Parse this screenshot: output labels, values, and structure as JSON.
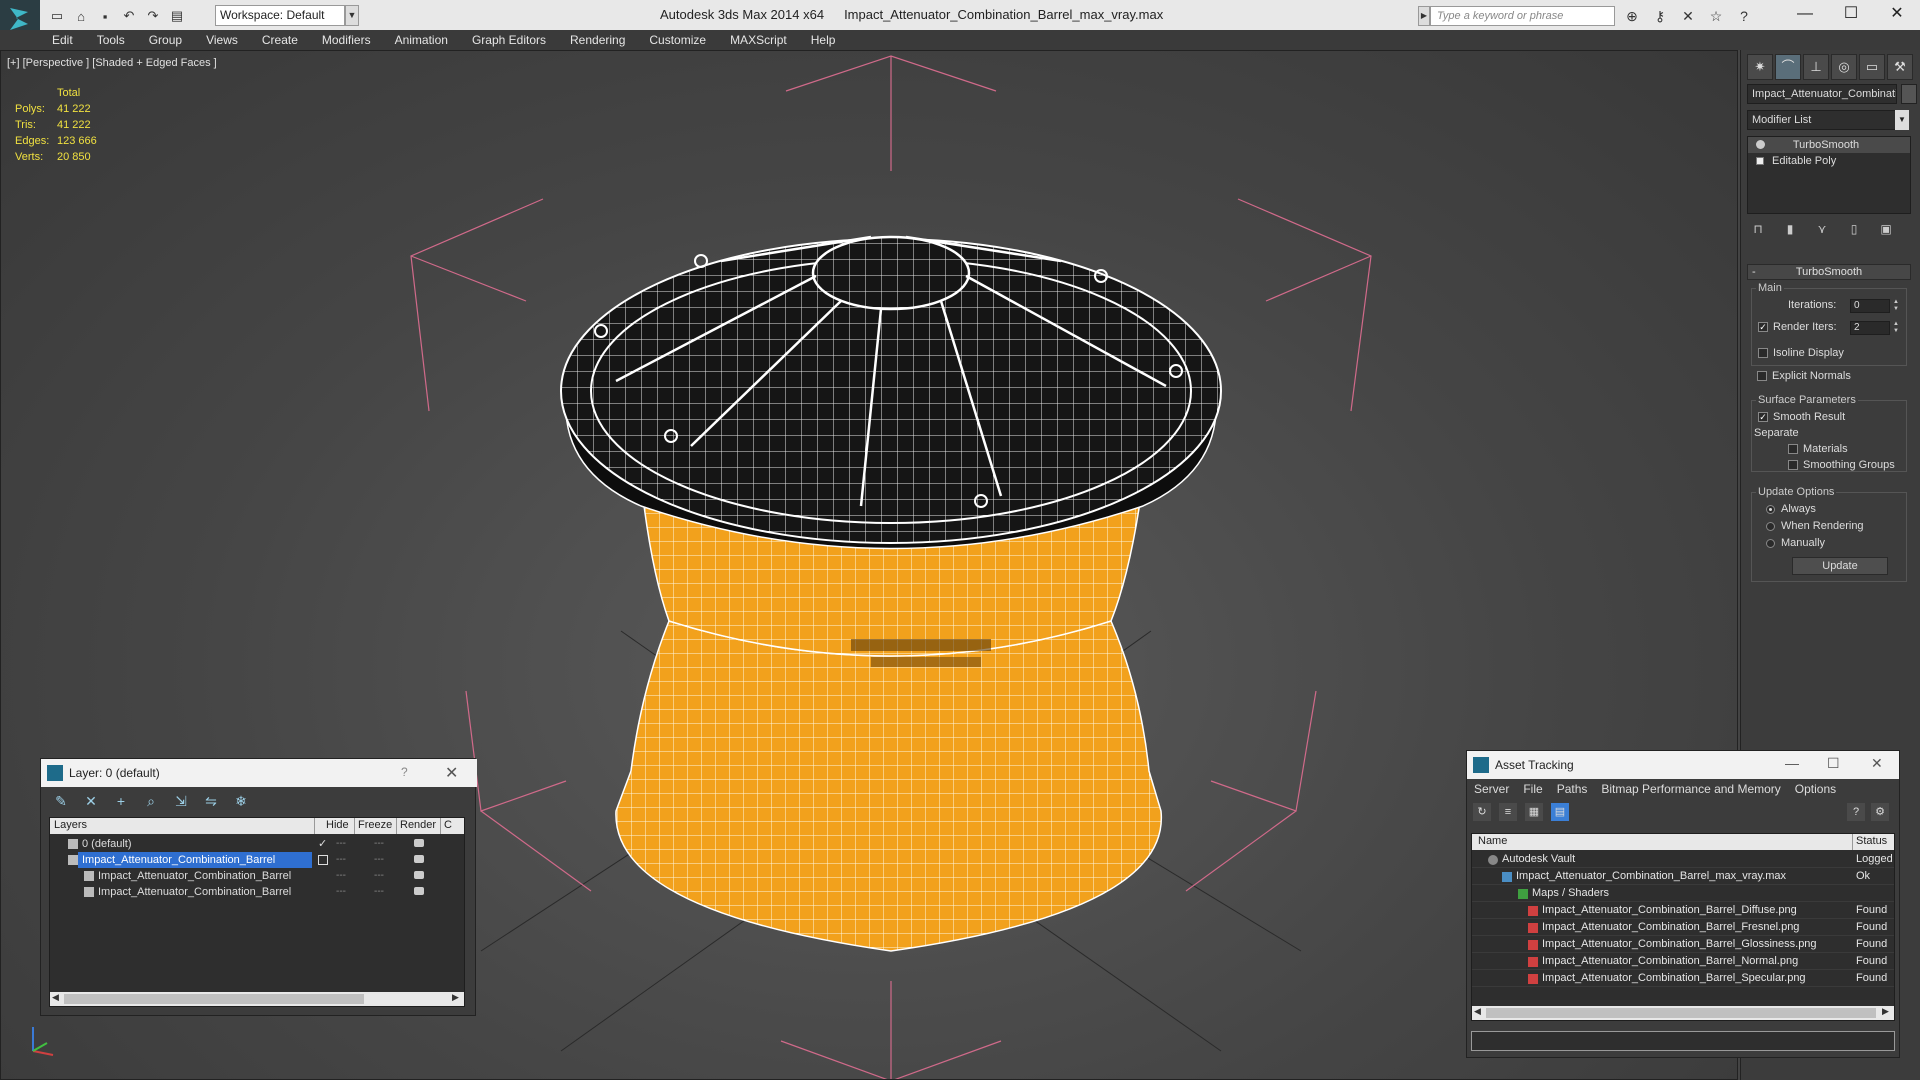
{
  "app": {
    "name": "Autodesk 3ds Max  2014 x64",
    "file": "Impact_Attenuator_Combination_Barrel_max_vray.max",
    "workspace": "Workspace: Default",
    "search_placeholder": "Type a keyword or phrase"
  },
  "menu": [
    "Edit",
    "Tools",
    "Group",
    "Views",
    "Create",
    "Modifiers",
    "Animation",
    "Graph Editors",
    "Rendering",
    "Customize",
    "MAXScript",
    "Help"
  ],
  "viewport": {
    "label": "[+] [Perspective ] [Shaded + Edged Faces ]",
    "stats": {
      "total_label": "Total",
      "rows": [
        {
          "label": "Polys:",
          "value": "41 222"
        },
        {
          "label": "Tris:",
          "value": "41 222"
        },
        {
          "label": "Edges:",
          "value": "123 666"
        },
        {
          "label": "Verts:",
          "value": "20 850"
        }
      ]
    },
    "colors": {
      "wireframe": "#ffffff",
      "barrel": "#f0a020",
      "bbox": "#e06080"
    }
  },
  "command_panel": {
    "object_name": "Impact_Attenuator_Combinati",
    "modifier_list": "Modifier List",
    "stack": [
      "TurboSmooth",
      "Editable Poly"
    ],
    "rollout": "TurboSmooth",
    "main_group": "Main",
    "iterations_label": "Iterations:",
    "iterations": "0",
    "render_iters_label": "Render Iters:",
    "render_iters": "2",
    "isoline": "Isoline Display",
    "explicit_normals": "Explicit Normals",
    "surface_group": "Surface Parameters",
    "smooth_result": "Smooth Result",
    "separate": "Separate",
    "materials": "Materials",
    "smoothing_groups": "Smoothing Groups",
    "update_group": "Update Options",
    "always": "Always",
    "when_rendering": "When Rendering",
    "manually": "Manually",
    "update_btn": "Update"
  },
  "layer_window": {
    "title": "Layer: 0 (default)",
    "help": "?",
    "columns": [
      "Layers",
      "Hide",
      "Freeze",
      "Render",
      "C"
    ],
    "rows": [
      {
        "name": "0 (default)",
        "indent": 0
      },
      {
        "name": "Impact_Attenuator_Combination_Barrel",
        "indent": 0
      },
      {
        "name": "Impact_Attenuator_Combination_Barrel",
        "indent": 1
      },
      {
        "name": "Impact_Attenuator_Combination_Barrel",
        "indent": 1
      }
    ]
  },
  "asset_tracking": {
    "title": "Asset Tracking",
    "menu": [
      "Server",
      "File",
      "Paths",
      "Bitmap Performance and Memory",
      "Options"
    ],
    "col_name": "Name",
    "col_status": "Status",
    "rows": [
      {
        "name": "Autodesk Vault",
        "status": "Logged",
        "indent": 1
      },
      {
        "name": "Impact_Attenuator_Combination_Barrel_max_vray.max",
        "status": "Ok",
        "indent": 2
      },
      {
        "name": "Maps / Shaders",
        "status": "",
        "indent": 3
      },
      {
        "name": "Impact_Attenuator_Combination_Barrel_Diffuse.png",
        "status": "Found",
        "indent": 4
      },
      {
        "name": "Impact_Attenuator_Combination_Barrel_Fresnel.png",
        "status": "Found",
        "indent": 4
      },
      {
        "name": "Impact_Attenuator_Combination_Barrel_Glossiness.png",
        "status": "Found",
        "indent": 4
      },
      {
        "name": "Impact_Attenuator_Combination_Barrel_Normal.png",
        "status": "Found",
        "indent": 4
      },
      {
        "name": "Impact_Attenuator_Combination_Barrel_Specular.png",
        "status": "Found",
        "indent": 4
      }
    ]
  }
}
